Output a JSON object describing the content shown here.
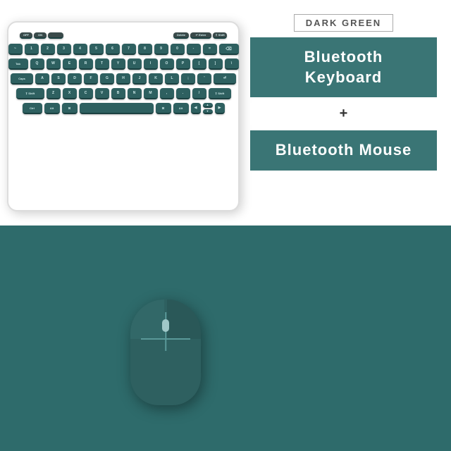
{
  "background": {
    "top_color": "#ffffff",
    "bottom_color": "#2e6b6b"
  },
  "info_panel": {
    "color_label": "DARK GREEN",
    "keyboard_text": "Bluetooth  Keyboard",
    "plus_sign": "+",
    "mouse_text": "Bluetooth  Mouse"
  },
  "keyboard": {
    "keys_description": "Dark green keys on white keyboard body"
  },
  "mouse": {
    "description": "Dark green bluetooth mouse"
  }
}
